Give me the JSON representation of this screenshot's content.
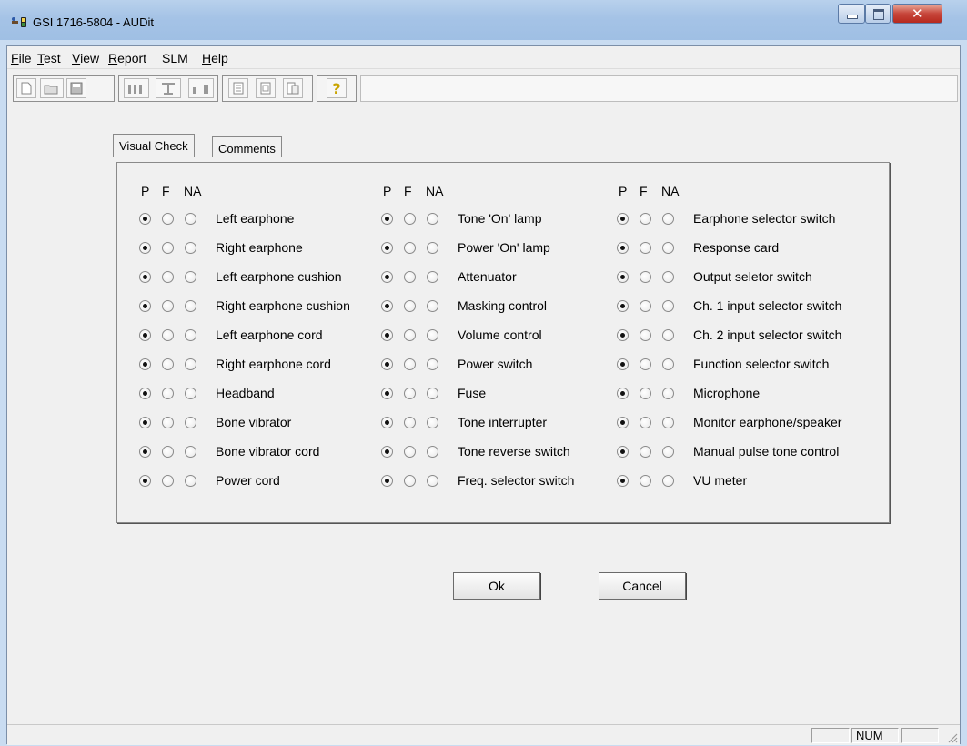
{
  "window": {
    "title": "GSI 1716-5804 - AUDit"
  },
  "menubar": {
    "items": [
      {
        "label": "File",
        "underline": "F",
        "rest": "ile"
      },
      {
        "label": "Test",
        "underline": "T",
        "rest": "est"
      },
      {
        "label": "View",
        "underline": "V",
        "rest": "iew"
      },
      {
        "label": "Report",
        "underline": "R",
        "rest": "eport"
      },
      {
        "label": "SLM",
        "underline": "",
        "rest": "SLM"
      },
      {
        "label": "Help",
        "underline": "H",
        "rest": "elp"
      }
    ]
  },
  "toolbar": {
    "icons": [
      "new-file-icon",
      "open-folder-icon",
      "save-disk-icon",
      "headphones-test-icon",
      "bone-test-icon",
      "speaker-test-icon",
      "report-icon",
      "report-preview-icon",
      "report-export-icon",
      "help-question-icon"
    ]
  },
  "tabs": [
    {
      "label": "Visual Check",
      "active": true
    },
    {
      "label": "Comments",
      "active": false
    }
  ],
  "col_headers": {
    "p": "P",
    "f": "F",
    "na": "NA"
  },
  "columns": [
    {
      "items": [
        {
          "label": "Left earphone",
          "value": "P"
        },
        {
          "label": "Right earphone",
          "value": "P"
        },
        {
          "label": "Left earphone cushion",
          "value": "P"
        },
        {
          "label": "Right earphone cushion",
          "value": "P"
        },
        {
          "label": "Left earphone cord",
          "value": "P"
        },
        {
          "label": "Right earphone cord",
          "value": "P"
        },
        {
          "label": "Headband",
          "value": "P"
        },
        {
          "label": "Bone vibrator",
          "value": "P"
        },
        {
          "label": "Bone vibrator cord",
          "value": "P"
        },
        {
          "label": "Power cord",
          "value": "P"
        }
      ]
    },
    {
      "items": [
        {
          "label": "Tone 'On' lamp",
          "value": "P"
        },
        {
          "label": "Power 'On' lamp",
          "value": "P"
        },
        {
          "label": "Attenuator",
          "value": "P"
        },
        {
          "label": "Masking control",
          "value": "P"
        },
        {
          "label": "Volume control",
          "value": "P"
        },
        {
          "label": "Power switch",
          "value": "P"
        },
        {
          "label": "Fuse",
          "value": "P"
        },
        {
          "label": "Tone interrupter",
          "value": "P"
        },
        {
          "label": "Tone reverse switch",
          "value": "P"
        },
        {
          "label": "Freq. selector switch",
          "value": "P"
        }
      ]
    },
    {
      "items": [
        {
          "label": "Earphone selector switch",
          "value": "P"
        },
        {
          "label": "Response card",
          "value": "P"
        },
        {
          "label": "Output seletor switch",
          "value": "P"
        },
        {
          "label": "Ch. 1 input selector switch",
          "value": "P"
        },
        {
          "label": "Ch. 2 input selector switch",
          "value": "P"
        },
        {
          "label": "Function selector switch",
          "value": "P"
        },
        {
          "label": "Microphone",
          "value": "P"
        },
        {
          "label": "Monitor earphone/speaker",
          "value": "P"
        },
        {
          "label": "Manual pulse tone control",
          "value": "P"
        },
        {
          "label": "VU meter",
          "value": "P"
        }
      ]
    }
  ],
  "buttons": {
    "ok": "Ok",
    "cancel": "Cancel"
  },
  "statusbar": {
    "num": "NUM"
  }
}
